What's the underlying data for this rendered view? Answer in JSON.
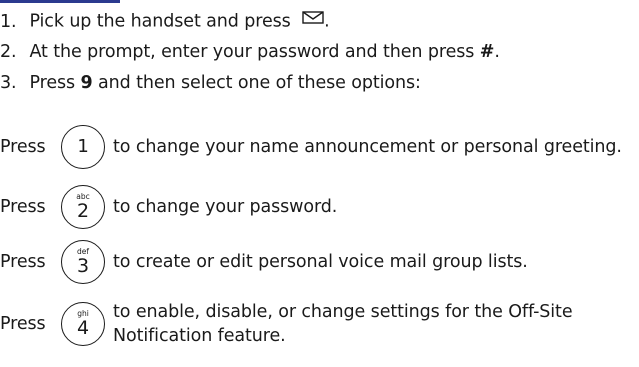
{
  "colors": {
    "accent": "#2b3a8f",
    "text": "#1a1a1a"
  },
  "steps": [
    {
      "number": "1.",
      "text_before": "Pick up the handset and press",
      "icon": "envelope-icon",
      "text_after": "."
    },
    {
      "number": "2.",
      "text_before": "At the prompt, enter your password and then press",
      "bold": "#",
      "text_after": "."
    },
    {
      "number": "3.",
      "text_before": "Press",
      "bold": "9",
      "text_after": "and then select one of these options:"
    }
  ],
  "options": [
    {
      "press": "Press",
      "key_letters": "",
      "key_digit": "1",
      "description": "to change your name announcement or personal greeting."
    },
    {
      "press": "Press",
      "key_letters": "abc",
      "key_digit": "2",
      "description": "to change your password."
    },
    {
      "press": "Press",
      "key_letters": "def",
      "key_digit": "3",
      "description": "to create or edit personal voice mail group lists."
    },
    {
      "press": "Press",
      "key_letters": "ghi",
      "key_digit": "4",
      "description": "to enable, disable, or change settings for the Off-Site Notification feature."
    }
  ]
}
